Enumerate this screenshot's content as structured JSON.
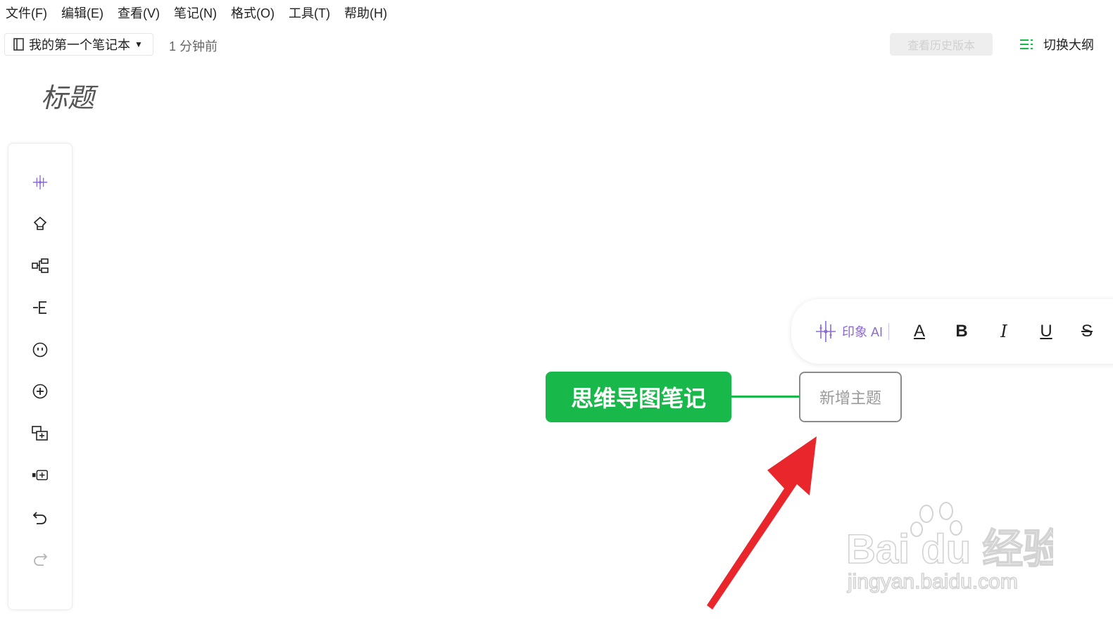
{
  "menu": [
    "文件(F)",
    "编辑(E)",
    "查看(V)",
    "笔记(N)",
    "格式(O)",
    "工具(T)",
    "帮助(H)"
  ],
  "toolbar": {
    "notebook_name": "我的第一个笔记本",
    "last_saved": "1 分钟前",
    "history_label": "查看历史版本",
    "outline_label": "切换大纲"
  },
  "note": {
    "title_placeholder": "标题"
  },
  "tool_rail": [
    {
      "name": "ai-sparkle-icon"
    },
    {
      "name": "topic-style-icon"
    },
    {
      "name": "structure-icon"
    },
    {
      "name": "add-subtopic-icon"
    },
    {
      "name": "emoji-icon"
    },
    {
      "name": "add-circle-icon"
    },
    {
      "name": "add-child-node-icon"
    },
    {
      "name": "add-sibling-node-icon"
    },
    {
      "name": "undo-icon"
    },
    {
      "name": "redo-icon"
    }
  ],
  "format_bar": {
    "ai_label": "印象 AI",
    "text_color": "A",
    "bold": "B",
    "italic": "I",
    "underline": "U",
    "strike": "S"
  },
  "mindmap": {
    "root": "思维导图笔记",
    "child": "新增主题",
    "accent": "#19b84a"
  },
  "watermark": {
    "line1": "Bai  du 经验",
    "line2": "jingyan.baidu.com"
  }
}
